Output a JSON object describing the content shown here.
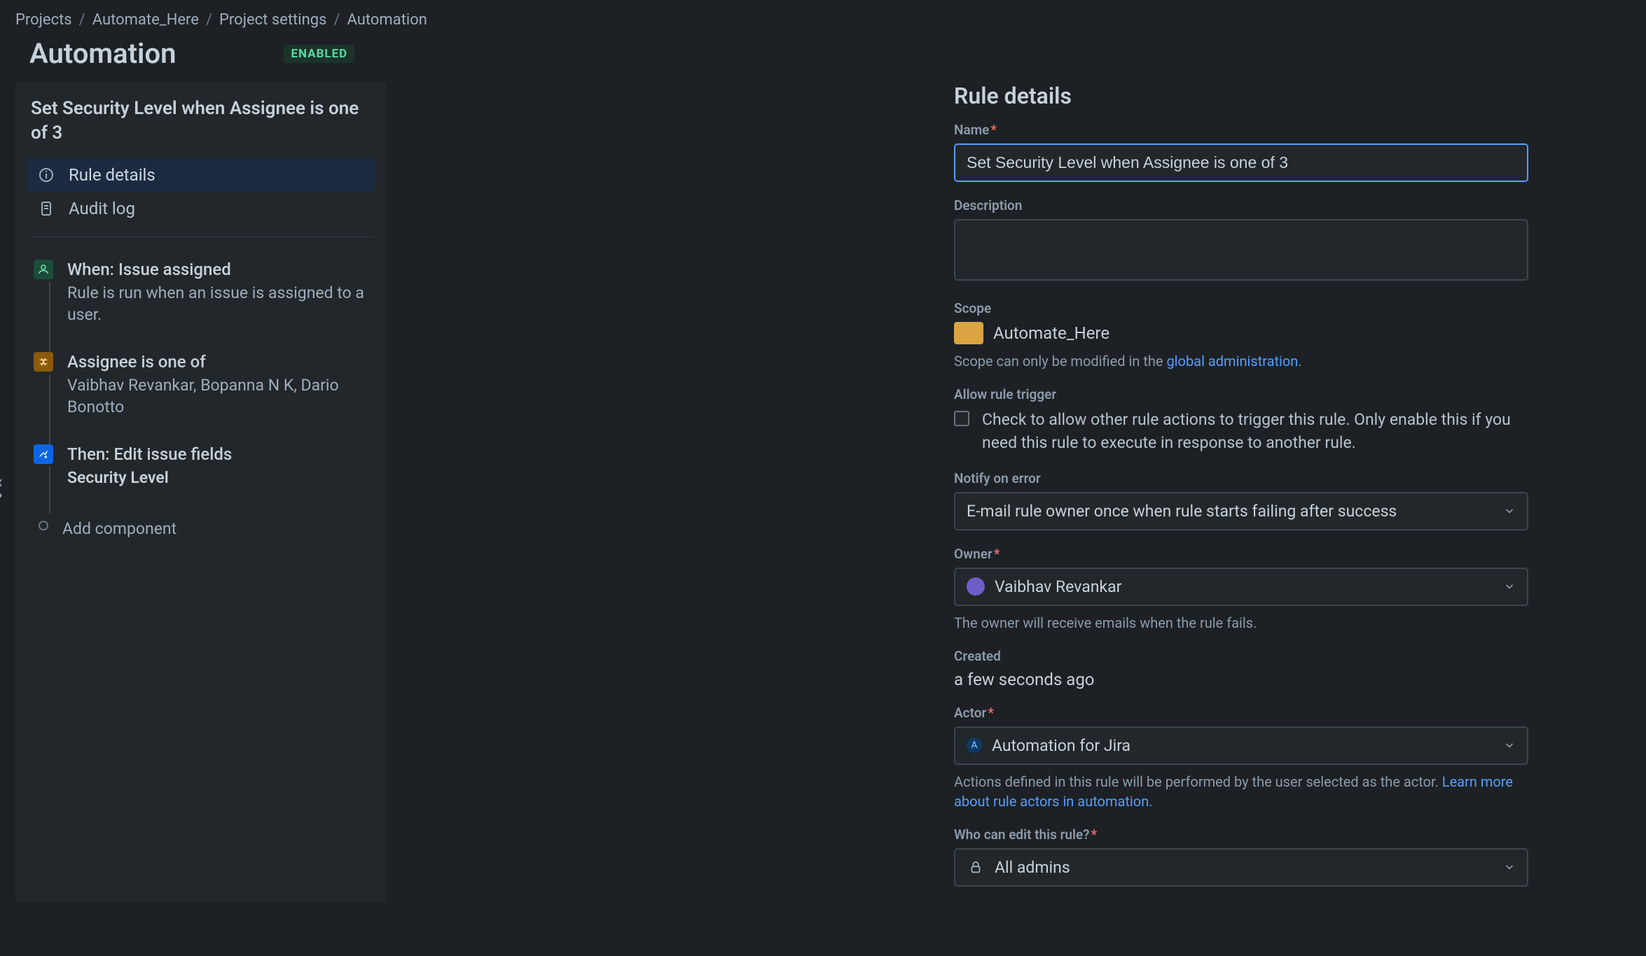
{
  "breadcrumb": {
    "items": [
      "Projects",
      "Automate_Here",
      "Project settings",
      "Automation"
    ]
  },
  "page": {
    "title": "Automation",
    "badge": "ENABLED"
  },
  "left": {
    "rule_title": "Set Security Level when Assignee is one of 3",
    "nav": {
      "rule_details": "Rule details",
      "audit_log": "Audit log"
    },
    "steps": {
      "trigger": {
        "title": "When: Issue assigned",
        "desc": "Rule is run when an issue is assigned to a user."
      },
      "condition": {
        "title": "Assignee is one of",
        "desc": "Vaibhav Revankar, Bopanna N K, Dario Bonotto"
      },
      "action": {
        "title": "Then: Edit issue fields",
        "sub": "Security Level"
      },
      "add": "Add component"
    }
  },
  "right": {
    "heading": "Rule details",
    "name_label": "Name",
    "name_value": "Set Security Level when Assignee is one of 3",
    "desc_label": "Description",
    "desc_value": "",
    "scope_label": "Scope",
    "scope_project": "Automate_Here",
    "scope_helper_prefix": "Scope can only be modified in the ",
    "scope_helper_link": "global administration",
    "trigger_label": "Allow rule trigger",
    "trigger_text": "Check to allow other rule actions to trigger this rule. Only enable this if you need this rule to execute in response to another rule.",
    "notify_label": "Notify on error",
    "notify_value": "E-mail rule owner once when rule starts failing after success",
    "owner_label": "Owner",
    "owner_value": "Vaibhav Revankar",
    "owner_helper": "The owner will receive emails when the rule fails.",
    "created_label": "Created",
    "created_value": "a few seconds ago",
    "actor_label": "Actor",
    "actor_value": "Automation for Jira",
    "actor_helper_prefix": "Actions defined in this rule will be performed by the user selected as the actor. ",
    "actor_helper_link": "Learn more about rule actors in automation.",
    "who_label": "Who can edit this rule?",
    "who_value": "All admins"
  }
}
